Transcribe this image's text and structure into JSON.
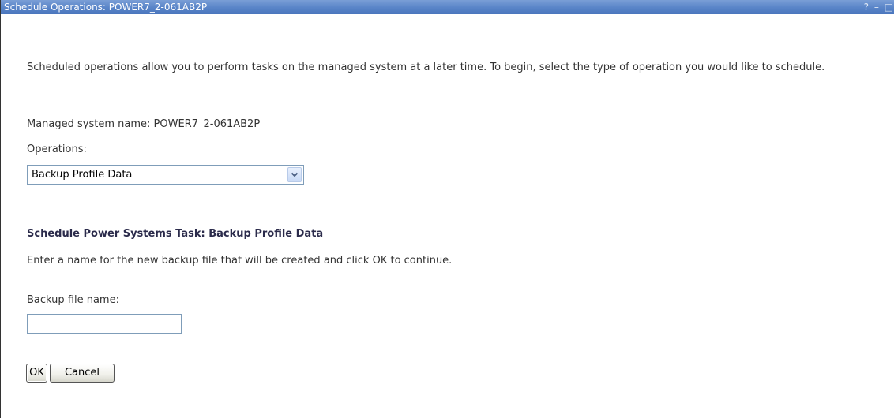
{
  "window": {
    "title": "Schedule Operations: POWER7_2-061AB2P",
    "controls": {
      "help": "?",
      "minimize": "–",
      "maximize": "□"
    }
  },
  "intro": {
    "text": "Scheduled operations allow you to perform tasks on the managed system at a later time. To begin, select the type of operation you would like to schedule."
  },
  "managed_system": {
    "label_text": "Managed system name: POWER7_2-061AB2P"
  },
  "operations": {
    "label": "Operations:",
    "selected": "Backup Profile Data"
  },
  "task": {
    "title": "Schedule Power Systems Task: Backup Profile Data",
    "instructions": "Enter a name for the new backup file that will be created and click OK to continue.",
    "file_label": "Backup file name:",
    "file_value": "",
    "file_placeholder": ""
  },
  "buttons": {
    "ok": "OK",
    "cancel": "Cancel"
  },
  "colors": {
    "titlebar": "#5b86c9",
    "section_title": "#2b2b4b"
  }
}
